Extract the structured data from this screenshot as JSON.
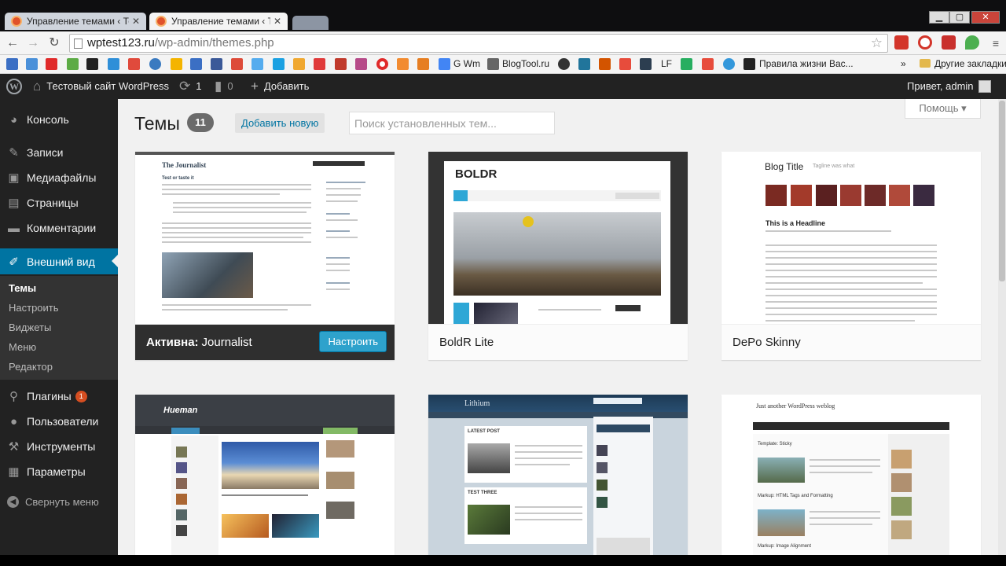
{
  "browser": {
    "tabs": [
      {
        "label": "Управление темами ‹ Те"
      },
      {
        "label": "Управление темами ‹ Те"
      }
    ],
    "url_host": "wptest123.ru",
    "url_path": "/wp-admin/themes.php",
    "bookmarks": {
      "gwm": "G Wm",
      "blogtool": "BlogTool.ru",
      "lf": "LF",
      "pravila": "Правила жизни Вас...",
      "more": "»",
      "other": "Другие закладки"
    }
  },
  "adminbar": {
    "site_name": "Тестовый сайт WordPress",
    "updates_count": "1",
    "comments_count": "0",
    "add_new": "Добавить",
    "greeting": "Привет, admin"
  },
  "sidebar": {
    "items": [
      {
        "label": "Консоль"
      },
      {
        "label": "Записи"
      },
      {
        "label": "Медиафайлы"
      },
      {
        "label": "Страницы"
      },
      {
        "label": "Комментарии"
      },
      {
        "label": "Внешний вид"
      },
      {
        "label": "Плагины",
        "badge": "1"
      },
      {
        "label": "Пользователи"
      },
      {
        "label": "Инструменты"
      },
      {
        "label": "Параметры"
      }
    ],
    "submenu": [
      {
        "label": "Темы"
      },
      {
        "label": "Настроить"
      },
      {
        "label": "Виджеты"
      },
      {
        "label": "Меню"
      },
      {
        "label": "Редактор"
      }
    ],
    "collapse": "Свернуть меню"
  },
  "main": {
    "help": "Помощь ▾",
    "title": "Темы",
    "count": "11",
    "add_new": "Добавить новую",
    "search_placeholder": "Поиск установленных тем..."
  },
  "themes": [
    {
      "active_label": "Активна:",
      "name": "Journalist",
      "customize": "Настроить",
      "shot_title": "The Journalist",
      "shot_heading": "Test or taste it"
    },
    {
      "name": "BoldR Lite",
      "shot_logo": "BOLDR"
    },
    {
      "name": "DePo Skinny",
      "shot_title": "Blog Title",
      "shot_tagline": "Tagline was what",
      "shot_heading": "This is a Headline"
    },
    {
      "shot_logo": "Hueman"
    },
    {
      "shot_logo": "Lithium",
      "shot_h1": "LATEST POST",
      "shot_h2": "TEST THREE"
    },
    {
      "shot_title": "Just another WordPress weblog",
      "shot_h1": "Template: Sticky",
      "shot_h2": "Markup: HTML Tags and Formatting",
      "shot_h3": "Markup: Image Alignment"
    }
  ],
  "colors": {
    "accent": "#0074a2",
    "admin_dark": "#222222",
    "button_blue": "#2ea2cc",
    "badge_orange": "#d54e21"
  }
}
